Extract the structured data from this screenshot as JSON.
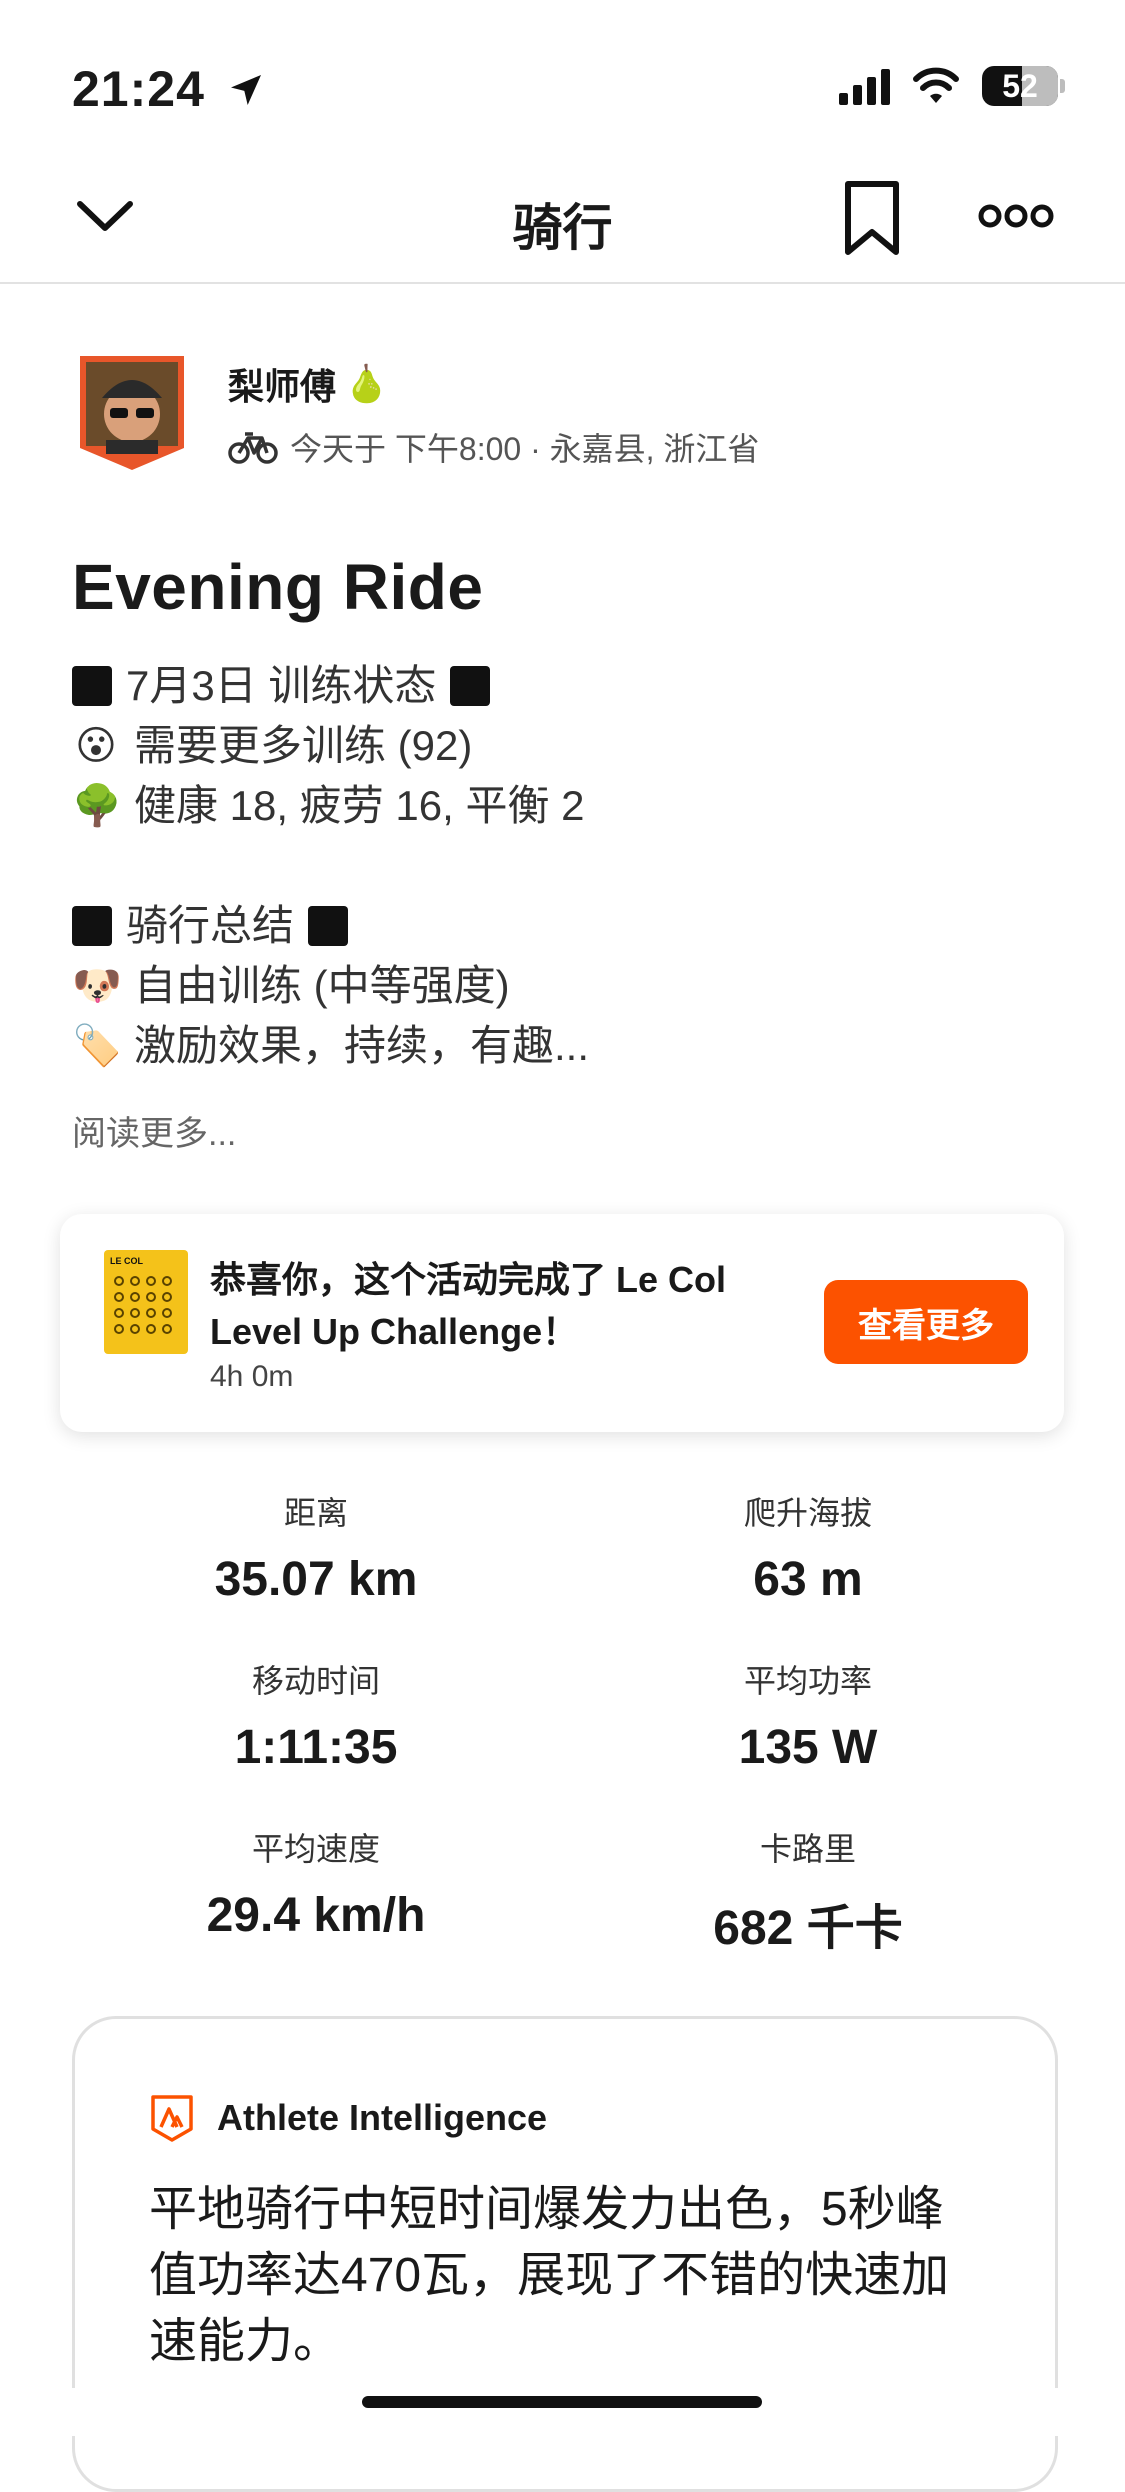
{
  "status_bar": {
    "time": "21:24",
    "battery": "52"
  },
  "header": {
    "title": "骑行"
  },
  "athlete": {
    "name": "梨师傅",
    "name_emoji": "🍐",
    "meta": "今天于 下午8:00 · 永嘉县, 浙江省"
  },
  "activity": {
    "title": "Evening Ride",
    "description": [
      {
        "lead": "square",
        "text": "7月3日 训练状态",
        "trail": "square"
      },
      {
        "lead": "😮",
        "text": "需要更多训练 (92)"
      },
      {
        "lead": "🌳",
        "text": "健康 18, 疲劳 16, 平衡 2"
      },
      {
        "lead": "",
        "text": ""
      },
      {
        "lead": "square",
        "text": "骑行总结",
        "trail": "square"
      },
      {
        "lead": "🐶",
        "text": "自由训练 (中等强度)"
      },
      {
        "lead": "🏷️",
        "text": "激励效果，持续，有趣..."
      }
    ],
    "read_more": "阅读更多..."
  },
  "challenge": {
    "badge_label": "LE COL",
    "text": "恭喜你，这个活动完成了 Le Col Level Up Challenge！",
    "duration": "4h 0m",
    "button": "查看更多"
  },
  "stats": [
    {
      "label": "距离",
      "value": "35.07 km"
    },
    {
      "label": "爬升海拔",
      "value": "63 m"
    },
    {
      "label": "移动时间",
      "value": "1:11:35"
    },
    {
      "label": "平均功率",
      "value": "135 W"
    },
    {
      "label": "平均速度",
      "value": "29.4 km/h"
    },
    {
      "label": "卡路里",
      "value": "682 千卡"
    }
  ],
  "ai_card": {
    "title": "Athlete Intelligence",
    "body": "平地骑行中短时间爆发力出色，5秒峰值功率达470瓦，展现了不错的快速加速能力。"
  },
  "colors": {
    "accent": "#fc5200",
    "badge": "#f4c21a"
  }
}
